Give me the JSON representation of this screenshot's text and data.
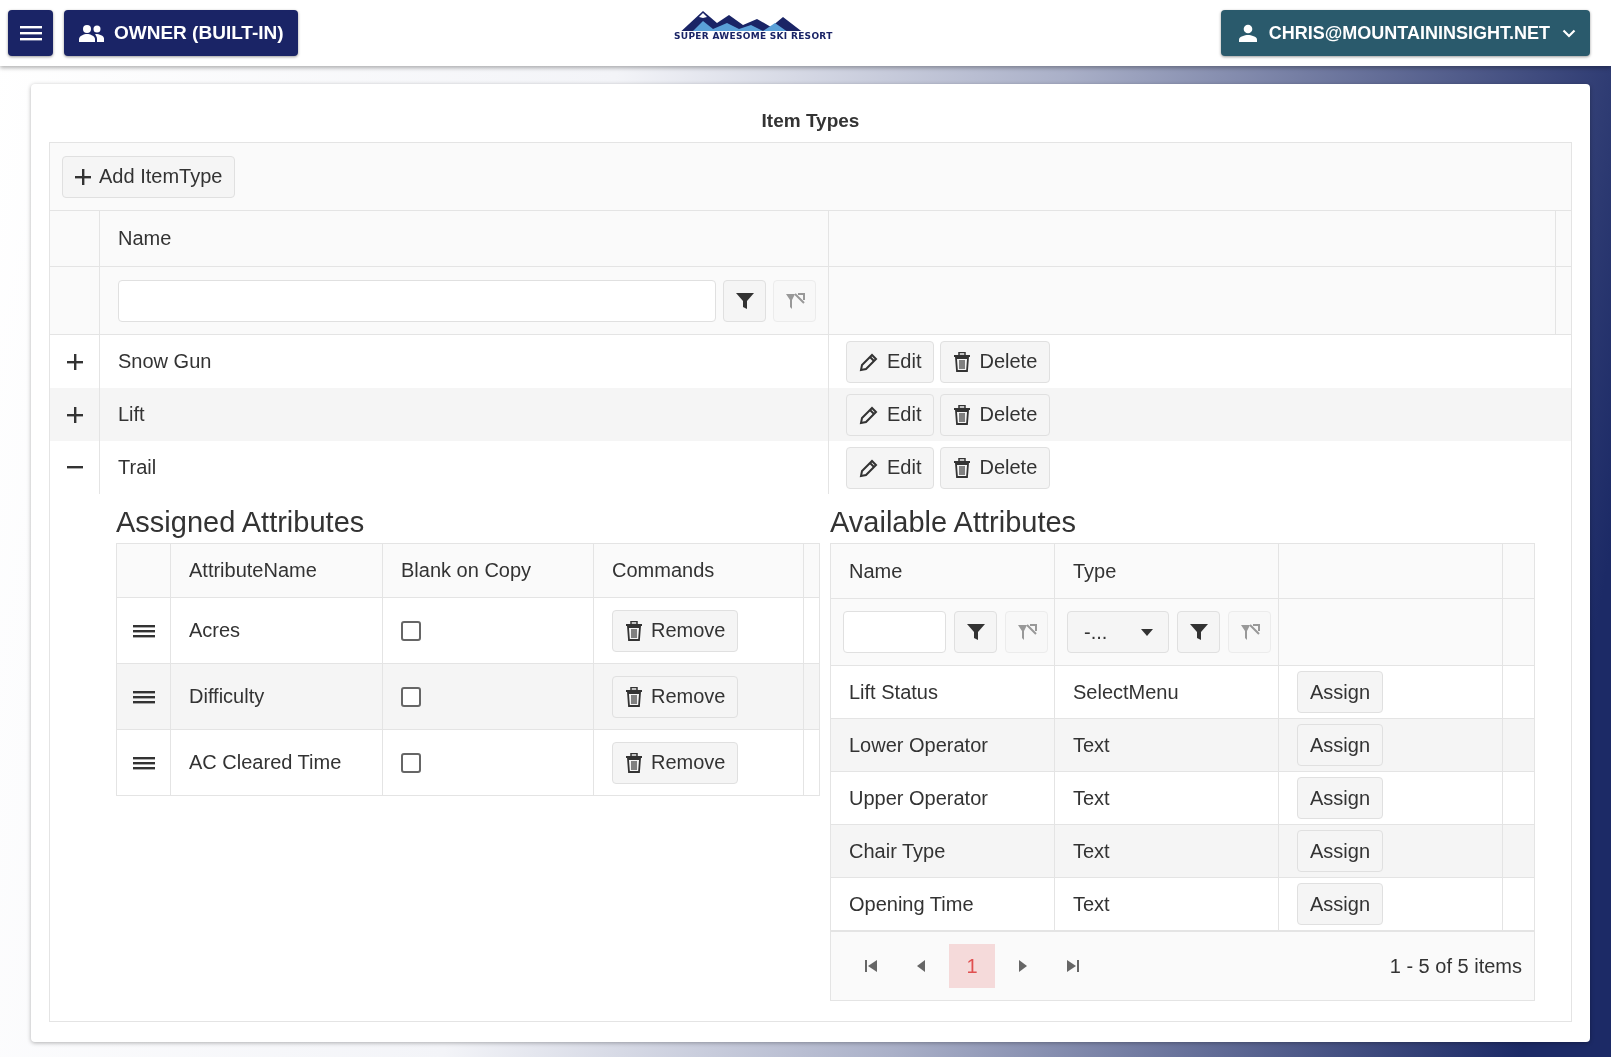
{
  "header": {
    "role_button": "OWNER (BUILT-IN)",
    "logo_text": "SUPER AWESOME SKI RESORT",
    "user_menu": "CHRIS@MOUNTAININSIGHT.NET"
  },
  "title": "Item Types",
  "toolbar": {
    "add_button": "Add ItemType"
  },
  "columns": [
    "Name"
  ],
  "rows": [
    {
      "name": "Snow Gun",
      "expanded": false,
      "edit": "Edit",
      "delete": "Delete"
    },
    {
      "name": "Lift",
      "expanded": false,
      "edit": "Edit",
      "delete": "Delete"
    },
    {
      "name": "Trail",
      "expanded": true,
      "edit": "Edit",
      "delete": "Delete"
    }
  ],
  "assigned": {
    "title": "Assigned Attributes",
    "columns": [
      "AttributeName",
      "Blank on Copy",
      "Commands"
    ],
    "rows": [
      {
        "name": "Acres",
        "blank_on_copy": false,
        "action": "Remove"
      },
      {
        "name": "Difficulty",
        "blank_on_copy": false,
        "action": "Remove"
      },
      {
        "name": "AC Cleared Time",
        "blank_on_copy": false,
        "action": "Remove"
      }
    ]
  },
  "available": {
    "title": "Available Attributes",
    "columns": [
      "Name",
      "Type"
    ],
    "type_filter": {
      "value": "-..."
    },
    "rows": [
      {
        "name": "Lift Status",
        "type": "SelectMenu",
        "action": "Assign"
      },
      {
        "name": "Lower Operator",
        "type": "Text",
        "action": "Assign"
      },
      {
        "name": "Upper Operator",
        "type": "Text",
        "action": "Assign"
      },
      {
        "name": "Chair Type",
        "type": "Text",
        "action": "Assign"
      },
      {
        "name": "Opening Time",
        "type": "Text",
        "action": "Assign"
      }
    ],
    "pager": {
      "pages": [
        {
          "label": "1",
          "selected": true
        }
      ],
      "summary": "1 - 5 of 5 items"
    }
  }
}
